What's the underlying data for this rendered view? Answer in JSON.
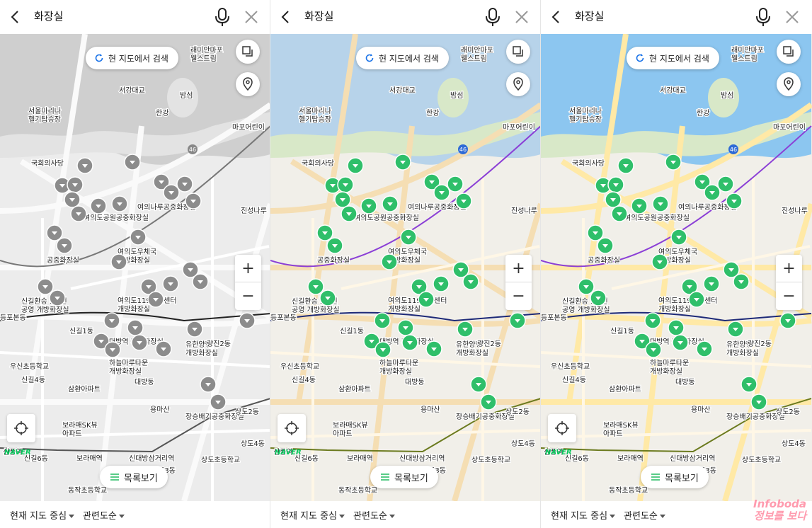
{
  "search": {
    "query": "화장실"
  },
  "map_buttons": {
    "research": "현 지도에서 검색",
    "list_view": "목록보기",
    "zoom_in": "+",
    "zoom_out": "−"
  },
  "bottom": {
    "filter_center": "현재 지도 중심",
    "filter_relevance": "관련도순"
  },
  "brand": {
    "map_logo": "NAVER"
  },
  "watermark": {
    "line1": "Infoboda",
    "line2": "정보를 보다"
  },
  "colors": {
    "marker_gray": "#8c8c8c",
    "marker_green": "#2fbf6a",
    "water_color": "#b7d3ea",
    "water_vivid": "#8cc6f0",
    "park_color": "#d8e8c8"
  },
  "panels": [
    {
      "theme": "grayscale"
    },
    {
      "theme": "color"
    },
    {
      "theme": "vivid"
    }
  ],
  "map_labels": {
    "place1": "서울마리나\n헬기탑승장",
    "place2": "서강대교",
    "place3": "밤섬",
    "place4": "한강",
    "place5": "래미안마포\n웰스트림",
    "place6": "마포어린이",
    "place7": "국회의사당",
    "place8": "여의나루공중화장실",
    "place9": "여의도공원공중화장실",
    "place10": "여의도우체국\n개방화장실",
    "place11": "공중화장실",
    "place12": "신길환승 5호선\n공영 개방화장실",
    "place13": "여의도119안전센터\n개방화장실",
    "place14": "대방역 개방화장실",
    "place15": "유한양행\n개방화장실",
    "place16": "하늘마루타운\n개방화장실",
    "place17": "장승배기공중화장실",
    "place18": "우신초등학교",
    "place19": "신길4동",
    "place20": "신길1동",
    "place21": "대방동",
    "place22": "삼환아파트",
    "place23": "보라매SK뷰\n아파트",
    "place24": "보라매역",
    "place25": "신대방삼거리역",
    "place26": "상도초등학교",
    "place27": "상도3동",
    "place28": "신길6동",
    "place29": "진성나루",
    "place30": "용마산",
    "place31": "상도4동",
    "place32": "량진2동",
    "place33": "등포본동",
    "place34": "상도2동",
    "place35": "신풍역",
    "place36": "동작초등학교",
    "route": "46"
  }
}
